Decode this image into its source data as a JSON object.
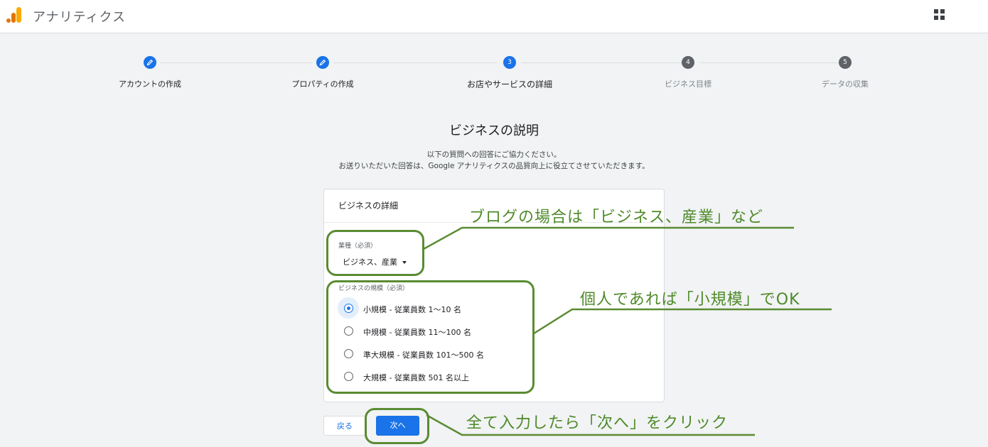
{
  "app": {
    "title": "アナリティクス"
  },
  "colors": {
    "accent": "#1a73e8",
    "annotation": "#5a8b32",
    "logo_orange": "#f9ab00",
    "logo_dark": "#e37400"
  },
  "stepper": {
    "steps": [
      {
        "number": "",
        "label": "アカウントの作成",
        "state": "done"
      },
      {
        "number": "",
        "label": "プロパティの作成",
        "state": "done"
      },
      {
        "number": "3",
        "label": "お店やサービスの詳細",
        "state": "active"
      },
      {
        "number": "4",
        "label": "ビジネス目標",
        "state": "todo"
      },
      {
        "number": "5",
        "label": "データの収集",
        "state": "todo"
      }
    ]
  },
  "page": {
    "title": "ビジネスの説明",
    "description_line1": "以下の質問への回答にご協力ください。",
    "description_line2": "お送りいただいた回答は、Google アナリティクスの品質向上に役立てさせていただきます。"
  },
  "card": {
    "title": "ビジネスの詳細",
    "industry_label": "業種（必須）",
    "industry_value": "ビジネス、産業",
    "size_label": "ビジネスの規模（必須）",
    "size_options": [
      {
        "label": "小規模 - 従業員数 1〜10 名",
        "checked": true
      },
      {
        "label": "中規模 - 従業員数 11〜100 名",
        "checked": false
      },
      {
        "label": "準大規模 - 従業員数 101〜500 名",
        "checked": false
      },
      {
        "label": "大規模 - 従業員数 501 名以上",
        "checked": false
      }
    ]
  },
  "buttons": {
    "back": "戻る",
    "next": "次へ"
  },
  "annotations": {
    "industry": "ブログの場合は「ビジネス、産業」など",
    "size": "個人であれば「小規模」でOK",
    "next": "全て入力したら「次へ」をクリック"
  }
}
